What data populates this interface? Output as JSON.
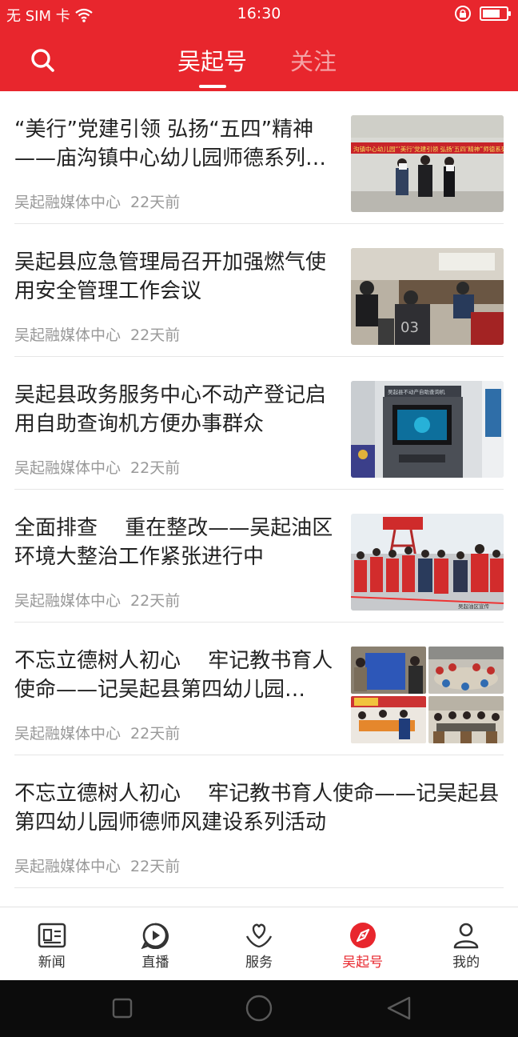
{
  "status_bar": {
    "carrier": "无 SIM 卡",
    "time": "16:30",
    "battery_level": 0.75
  },
  "header": {
    "tabs": [
      {
        "label": "吴起号",
        "active": true
      },
      {
        "label": "关注",
        "active": false
      }
    ]
  },
  "articles": [
    {
      "title": "“美行”党建引领 弘扬“五四”精神——庙沟镇中心幼儿园师德系列…",
      "source": "吴起融媒体中心",
      "time": "22天前",
      "thumb_caption": "沟镇中心幼儿园“‘美行’党建引领 弘扬‘五四’精神”师德系列活动"
    },
    {
      "title": "吴起县应急管理局召开加强燃气使用安全管理工作会议",
      "source": "吴起融媒体中心",
      "time": "22天前"
    },
    {
      "title": "吴起县政务服务中心不动产登记启用自助查询机方便办事群众",
      "source": "吴起融媒体中心",
      "time": "22天前",
      "thumb_caption": "吴起县不动产自助查询机"
    },
    {
      "title": "全面排查　 重在整改——吴起油区环境大整治工作紧张进行中",
      "source": "吴起融媒体中心",
      "time": "22天前",
      "thumb_caption": "吴起油区宣传"
    },
    {
      "title": "不忘立德树人初心　 牢记教书育人使命——记吴起县第四幼儿园…",
      "source": "吴起融媒体中心",
      "time": "22天前"
    },
    {
      "title": "不忘立德树人初心　 牢记教书育人使命——记吴起县第四幼儿园师德师风建设系列活动",
      "source": "吴起融媒体中心",
      "time": "22天前"
    }
  ],
  "bottom_nav": [
    {
      "label": "新闻",
      "icon": "newspaper-icon",
      "active": false
    },
    {
      "label": "直播",
      "icon": "play-icon",
      "active": false
    },
    {
      "label": "服务",
      "icon": "service-heart-icon",
      "active": false
    },
    {
      "label": "吴起号",
      "icon": "compass-icon",
      "active": true
    },
    {
      "label": "我的",
      "icon": "person-icon",
      "active": false
    }
  ],
  "colors": {
    "brand_red": "#e8262d",
    "muted_text": "#999999"
  }
}
